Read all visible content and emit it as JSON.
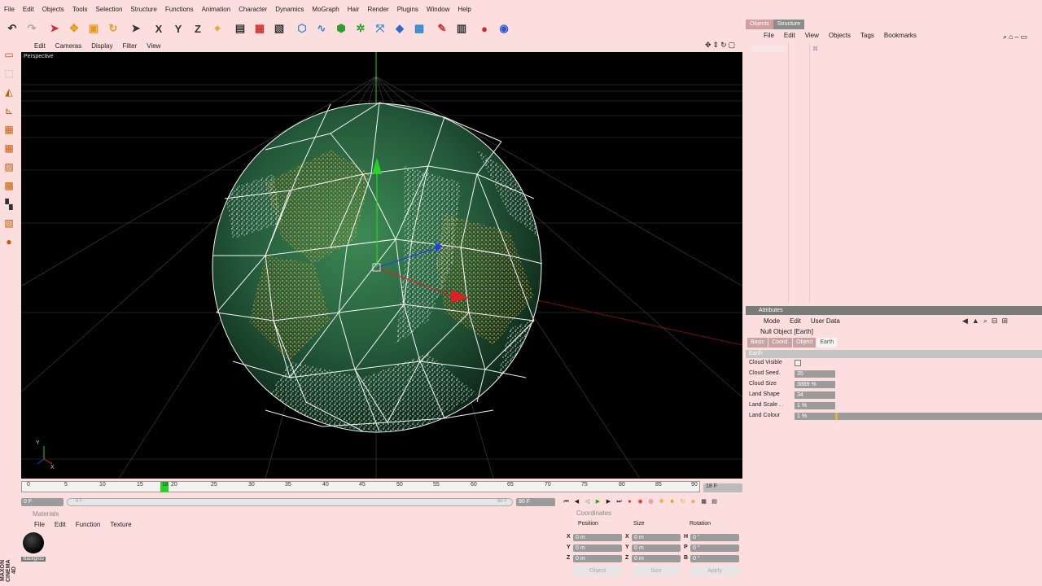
{
  "menubar": [
    "File",
    "Edit",
    "Objects",
    "Tools",
    "Selection",
    "Structure",
    "Functions",
    "Animation",
    "Character",
    "Dynamics",
    "MoGraph",
    "Hair",
    "Render",
    "Plugins",
    "Window",
    "Help"
  ],
  "toolbar": {
    "axis_x": "X",
    "axis_y": "Y",
    "axis_z": "Z"
  },
  "viewport": {
    "menu": [
      "Edit",
      "Cameras",
      "Display",
      "Filter",
      "View"
    ],
    "label": "Perspective",
    "axis_y": "Y",
    "axis_x": "X"
  },
  "timeline": {
    "ticks": [
      "0",
      "5",
      "10",
      "15",
      "18",
      "20",
      "25",
      "30",
      "35",
      "40",
      "45",
      "50",
      "55",
      "60",
      "65",
      "70",
      "75",
      "80",
      "85",
      "90"
    ],
    "current_frame": "18 F",
    "start_field": "0 F",
    "range_start": "0 F",
    "range_end": "90 F",
    "end_field": "90 F"
  },
  "materials": {
    "header": "Materials",
    "menu": [
      "File",
      "Edit",
      "Function",
      "Texture"
    ],
    "item_label": "Backgrou"
  },
  "coordinates": {
    "header": "Coordinates",
    "col_position": "Position",
    "col_size": "Size",
    "col_rotation": "Rotation",
    "rows": [
      {
        "pl": "X",
        "pv": "0 m",
        "sl": "X",
        "sv": "0 m",
        "rl": "H",
        "rv": "0 °"
      },
      {
        "pl": "Y",
        "pv": "0 m",
        "sl": "Y",
        "sv": "0 m",
        "rl": "P",
        "rv": "0 °"
      },
      {
        "pl": "Z",
        "pv": "0 m",
        "sl": "Z",
        "sv": "0 m",
        "rl": "B",
        "rv": "0 °"
      }
    ],
    "mode": "Object",
    "size_mode": "Size",
    "apply": "Apply"
  },
  "objects_panel": {
    "tabs": [
      "Objects",
      "Structure"
    ],
    "menu": [
      "File",
      "Edit",
      "View",
      "Objects",
      "Tags",
      "Bookmarks"
    ]
  },
  "attributes": {
    "title": "Attributes",
    "menu": [
      "Mode",
      "Edit",
      "User Data"
    ],
    "object_name": "Null Object [Earth]",
    "tabs": [
      "Basic",
      "Coord.",
      "Object",
      "Earth"
    ],
    "group": "Earth",
    "params": [
      {
        "label": "Cloud Visible",
        "type": "checkbox"
      },
      {
        "label": "Cloud Seed.",
        "value": "35"
      },
      {
        "label": "Cloud Size",
        "value": "3889 %"
      },
      {
        "label": "Land Shape",
        "value": "34"
      },
      {
        "label": "Land Scale . .",
        "value": "1 %"
      },
      {
        "label": "Land Colour",
        "value": "1 %",
        "slider": 0.01
      }
    ]
  },
  "side_logo": "MAXON CINEMA 4D",
  "colors": {
    "background": "#fcdede",
    "viewport": "#000000",
    "sphere_green": "#2f6b3d",
    "sphere_yellow": "#d8a431",
    "playhead": "#2bd12b",
    "slider_fill": "#e2b33c"
  }
}
